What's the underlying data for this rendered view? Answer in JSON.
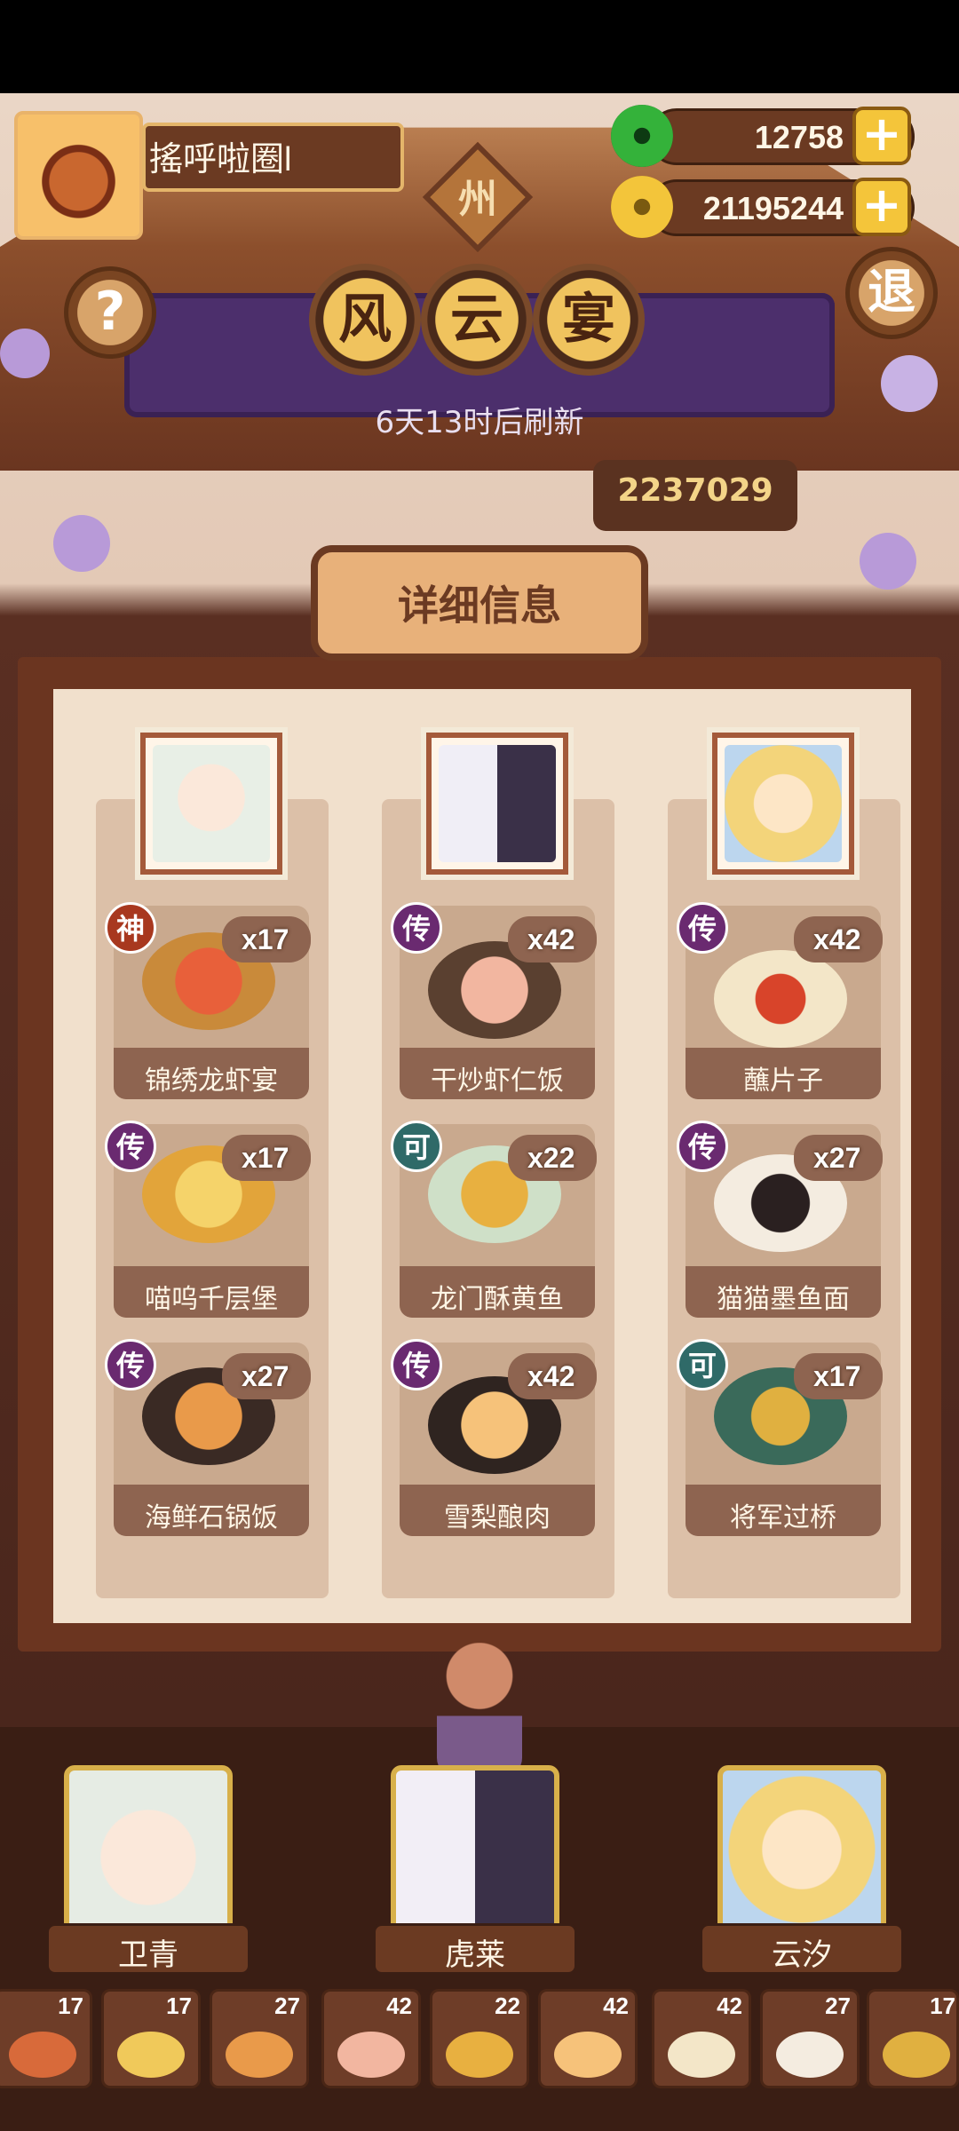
{
  "player": {
    "name": "搖呼啦圈l"
  },
  "region_badge": "州",
  "currency": {
    "jade": "12758",
    "coins": "21195244",
    "plus": "+"
  },
  "buttons": {
    "help": "?",
    "exit": "退"
  },
  "title": [
    "风",
    "云",
    "宴"
  ],
  "refresh_text": "6天13时后刷新",
  "score": "2237029",
  "detail_title": "详细信息",
  "columns": [
    {
      "dishes": [
        {
          "tier": "神",
          "count": "x17",
          "name": "锦绣龙虾宴"
        },
        {
          "tier": "传",
          "count": "x17",
          "name": "喵呜千层堡"
        },
        {
          "tier": "传",
          "count": "x27",
          "name": "海鲜石锅饭"
        }
      ]
    },
    {
      "dishes": [
        {
          "tier": "传",
          "count": "x42",
          "name": "干炒虾仁饭"
        },
        {
          "tier": "可",
          "count": "x22",
          "name": "龙门酥黄鱼"
        },
        {
          "tier": "传",
          "count": "x42",
          "name": "雪梨酿肉"
        }
      ]
    },
    {
      "dishes": [
        {
          "tier": "传",
          "count": "x42",
          "name": "蘸片子"
        },
        {
          "tier": "传",
          "count": "x27",
          "name": "猫猫墨鱼面"
        },
        {
          "tier": "可",
          "count": "x17",
          "name": "将军过桥"
        }
      ]
    }
  ],
  "characters": [
    "卫青",
    "虎莱",
    "云汐"
  ],
  "inventory_counts": [
    "17",
    "17",
    "27",
    "42",
    "22",
    "42",
    "42",
    "27",
    "17"
  ]
}
